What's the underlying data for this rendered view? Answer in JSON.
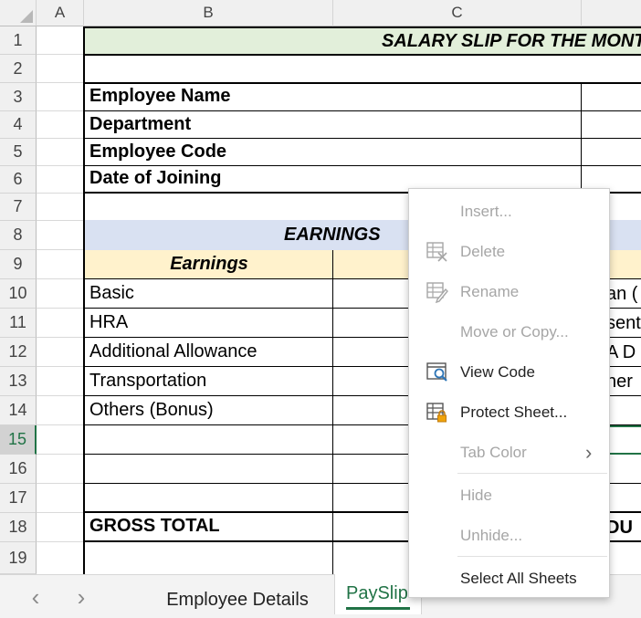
{
  "columns": [
    "",
    "A",
    "B",
    "C",
    ""
  ],
  "rows": [
    "1",
    "2",
    "3",
    "4",
    "5",
    "6",
    "7",
    "8",
    "9",
    "10",
    "11",
    "12",
    "13",
    "14",
    "15",
    "16",
    "17",
    "18",
    "19"
  ],
  "title": "SALARY SLIP FOR THE MONTH",
  "labels": {
    "employee_name": "Employee Name",
    "department": "Department",
    "employee_code": "Employee Code",
    "date_of_joining": "Date of Joining",
    "earnings_header": "EARNINGS",
    "earnings_sub": "Earnings",
    "basic": "Basic",
    "hra": "HRA",
    "additional_allowance": "Additional Allowance",
    "transportation": "Transportation",
    "others_bonus": "Others (Bonus)",
    "gross_total": "GROSS TOTAL"
  },
  "partial_right": {
    "r10": "an (",
    "r11": "sent",
    "r12": "A D",
    "r13": "her",
    "r18": "DU"
  },
  "tabs": {
    "prev": "‹",
    "next": "›",
    "employee_details": "Employee Details",
    "payslip": "PaySlip"
  },
  "menu": {
    "insert": "Insert...",
    "delete": "Delete",
    "rename": "Rename",
    "move_copy": "Move or Copy...",
    "view_code": "View Code",
    "protect_sheet": "Protect Sheet...",
    "tab_color": "Tab Color",
    "tab_color_arrow": "›",
    "hide": "Hide",
    "unhide": "Unhide...",
    "select_all": "Select All Sheets"
  },
  "colors": {
    "title_fill": "#e2efda",
    "earnings_fill": "#d9e1f2",
    "sub_fill": "#fff2cc",
    "selected_row": "#217346"
  }
}
